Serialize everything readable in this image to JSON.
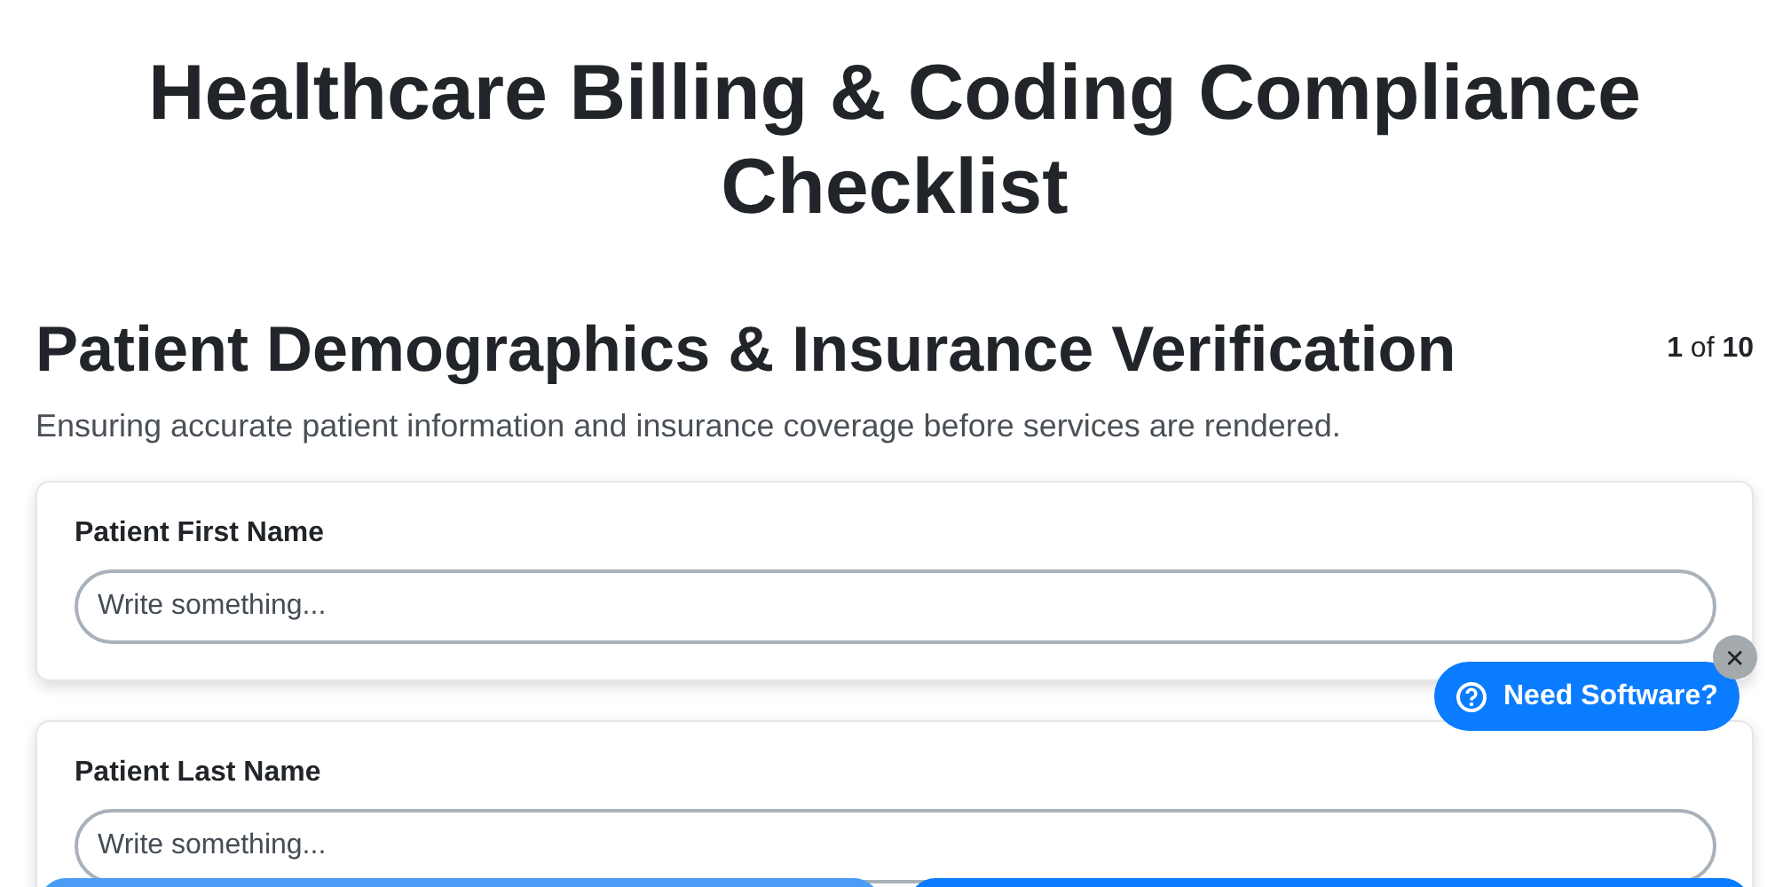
{
  "title": "Healthcare Billing & Coding Compliance Checklist",
  "section": {
    "heading": "Patient Demographics & Insurance Verification",
    "progress": "**1** of **10**",
    "description": "Ensuring accurate patient information and insurance coverage before services are rendered."
  },
  "fields": [
    {
      "label": "Patient First Name",
      "placeholder": "Write something..."
    },
    {
      "label": "Patient Last Name",
      "placeholder": "Write something..."
    }
  ],
  "help_button": {
    "label": "Need Software?",
    "close": "✕"
  }
}
